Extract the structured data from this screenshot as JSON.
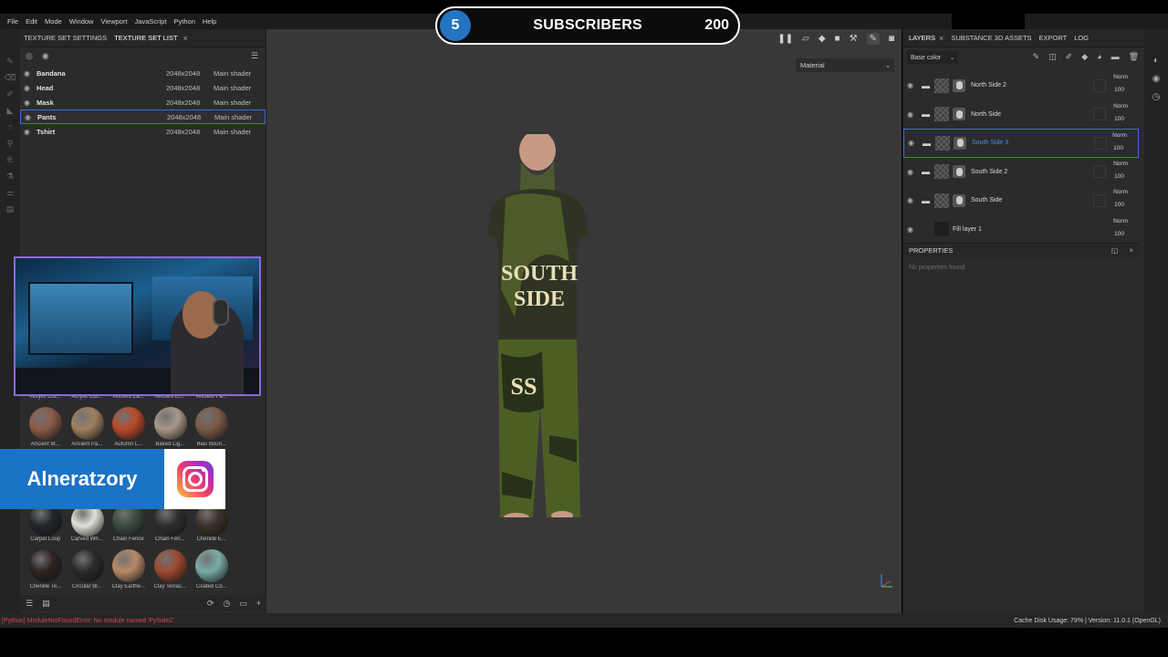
{
  "menu": [
    "File",
    "Edit",
    "Mode",
    "Window",
    "Viewport",
    "JavaScript",
    "Python",
    "Help"
  ],
  "subscribers": {
    "count": "5",
    "label": "SUBSCRIBERS",
    "goal": "200"
  },
  "texture_panel": {
    "tab_settings": "TEXTURE SET SETTINGS",
    "tab_list": "TEXTURE SET LIST",
    "rows": [
      {
        "name": "Bandana",
        "resolution": "2048x2048",
        "shader": "Main shader"
      },
      {
        "name": "Head",
        "resolution": "2048x2048",
        "shader": "Main shader"
      },
      {
        "name": "Mask",
        "resolution": "2048x2048",
        "shader": "Main shader"
      },
      {
        "name": "Pants",
        "resolution": "2048x2048",
        "shader": "Main shader"
      },
      {
        "name": "Tshirt",
        "resolution": "2048x2048",
        "shader": "Main shader"
      }
    ],
    "selected_row": "Pants"
  },
  "shelf": {
    "row1_labels": [
      "Acrylic Cot...",
      "Acrylic Cot...",
      "Ancient Ea...",
      "Ancient Er...",
      "Ancient Fa..."
    ],
    "row2_labels": [
      "Ancient M...",
      "Ancient Pa...",
      "Autumn L...",
      "Baked Lig...",
      "Bias Boun..."
    ],
    "row3_labels": [
      "Carpet Loop",
      "Carved Wh...",
      "Chain Fence",
      "Chain Fen...",
      "Chenille E..."
    ],
    "row4_labels": [
      "Chenille Te...",
      "Circular Bl...",
      "Clay Earthe...",
      "Clay Terrac...",
      "Coated Co..."
    ],
    "row2_colors": [
      "#8a5a48",
      "#a08060",
      "#b84a2a",
      "#a89888",
      "#7a5a48"
    ],
    "row3_colors": [
      "#22262c",
      "#e0e0dc",
      "#3a4a40",
      "#2e2e2e",
      "#3a3228"
    ],
    "row4_colors": [
      "#2c2222",
      "#2a2a2a",
      "#b88a68",
      "#9c4a30",
      "#7aaca8"
    ]
  },
  "instagram": {
    "handle": "Alneratzory"
  },
  "viewport": {
    "material_select": "Material",
    "shirt_text_line1": "SOUTH",
    "shirt_text_line2": "SIDE",
    "pants_text": "SS"
  },
  "right_panel": {
    "tab_layers": "LAYERS",
    "tab_assets": "SUBSTANCE 3D ASSETS",
    "tab_export": "EXPORT",
    "tab_log": "LOG",
    "channel": "Base color",
    "layers": [
      {
        "name": "North Side 2",
        "blend": "Norm",
        "opacity": "100"
      },
      {
        "name": "North Side",
        "blend": "Norm",
        "opacity": "100"
      },
      {
        "name": "South Side 3",
        "blend": "Norm",
        "opacity": "100"
      },
      {
        "name": "South Side 2",
        "blend": "Norm",
        "opacity": "100"
      },
      {
        "name": "South Side",
        "blend": "Norm",
        "opacity": "100"
      },
      {
        "name": "Fill layer 1",
        "blend": "Norm",
        "opacity": "100"
      }
    ],
    "selected_layer": "South Side 3",
    "properties_title": "PROPERTIES",
    "no_properties": "No properties found"
  },
  "status": {
    "error": "[Python] ModuleNotFoundError: No module named 'PySide2'",
    "right": "Cache Disk Usage:   79% | Version: 11.0.1 (OpenGL)"
  },
  "colors": {
    "accent": "#3b6fd0",
    "error": "#d44444",
    "webcam_border": "#8b6bd8",
    "instagram_blue": "#1a73c5"
  }
}
